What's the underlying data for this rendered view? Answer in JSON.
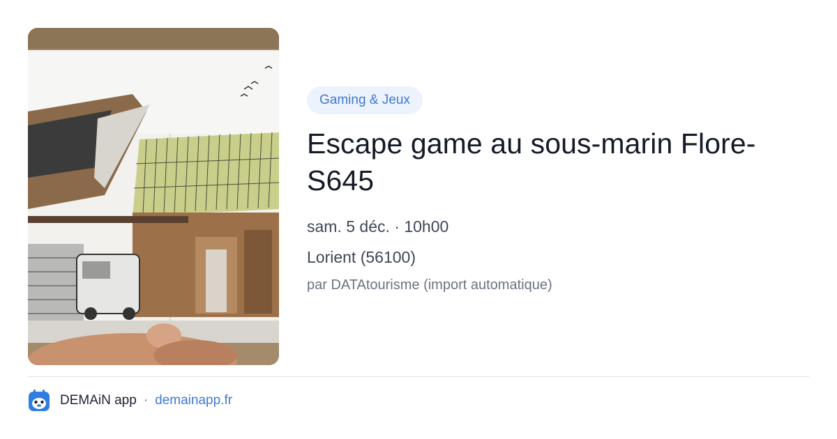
{
  "event": {
    "category": "Gaming & Jeux",
    "title": "Escape game au sous-marin Flore-S645",
    "datetime": "sam. 5 déc. · 10h00",
    "location": "Lorient (56100)",
    "source": "par DATAtourisme (import automatique)"
  },
  "image": {
    "subject": "watercolor sketchbook drawing of a submarine base building held in a hand"
  },
  "footer": {
    "app_name": "DEMAiN app",
    "separator": "·",
    "app_url": "demainapp.fr",
    "logo_icon": "demain-logo-icon"
  },
  "colors": {
    "accent": "#3f79d6",
    "badge_bg": "#ecf3fd",
    "title": "#141a28",
    "muted": "#6a7282",
    "logo_blue": "#2f7de1"
  }
}
